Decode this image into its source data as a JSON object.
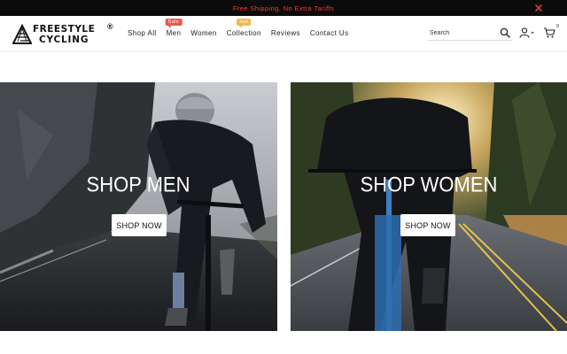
{
  "announcement": {
    "text": "Free Shipping, No Extra Tariffs",
    "text_color": "#ff3b30",
    "background": "#0b0b0b",
    "close_icon": "close-icon"
  },
  "brand": {
    "line1": "FREESTYLE",
    "line2": "CYCLING",
    "registered": "®"
  },
  "nav": {
    "items": [
      {
        "label": "Shop All"
      },
      {
        "label": "Men",
        "badge": "Sale"
      },
      {
        "label": "Women"
      },
      {
        "label": "Collection",
        "badge": "Hot"
      },
      {
        "label": "Reviews"
      },
      {
        "label": "Contact Us"
      }
    ],
    "badge_colors": {
      "sale": "#e8584a",
      "hot": "#f0b84a"
    }
  },
  "header_actions": {
    "search_placeholder": "Search",
    "search_icon": "search-icon",
    "account_icon": "user-icon",
    "cart_icon": "cart-icon",
    "cart_count": "0"
  },
  "banners": [
    {
      "title": "SHOP MEN",
      "cta": "SHOP NOW"
    },
    {
      "title": "SHOP WOMEN",
      "cta": "SHOP NOW"
    }
  ]
}
